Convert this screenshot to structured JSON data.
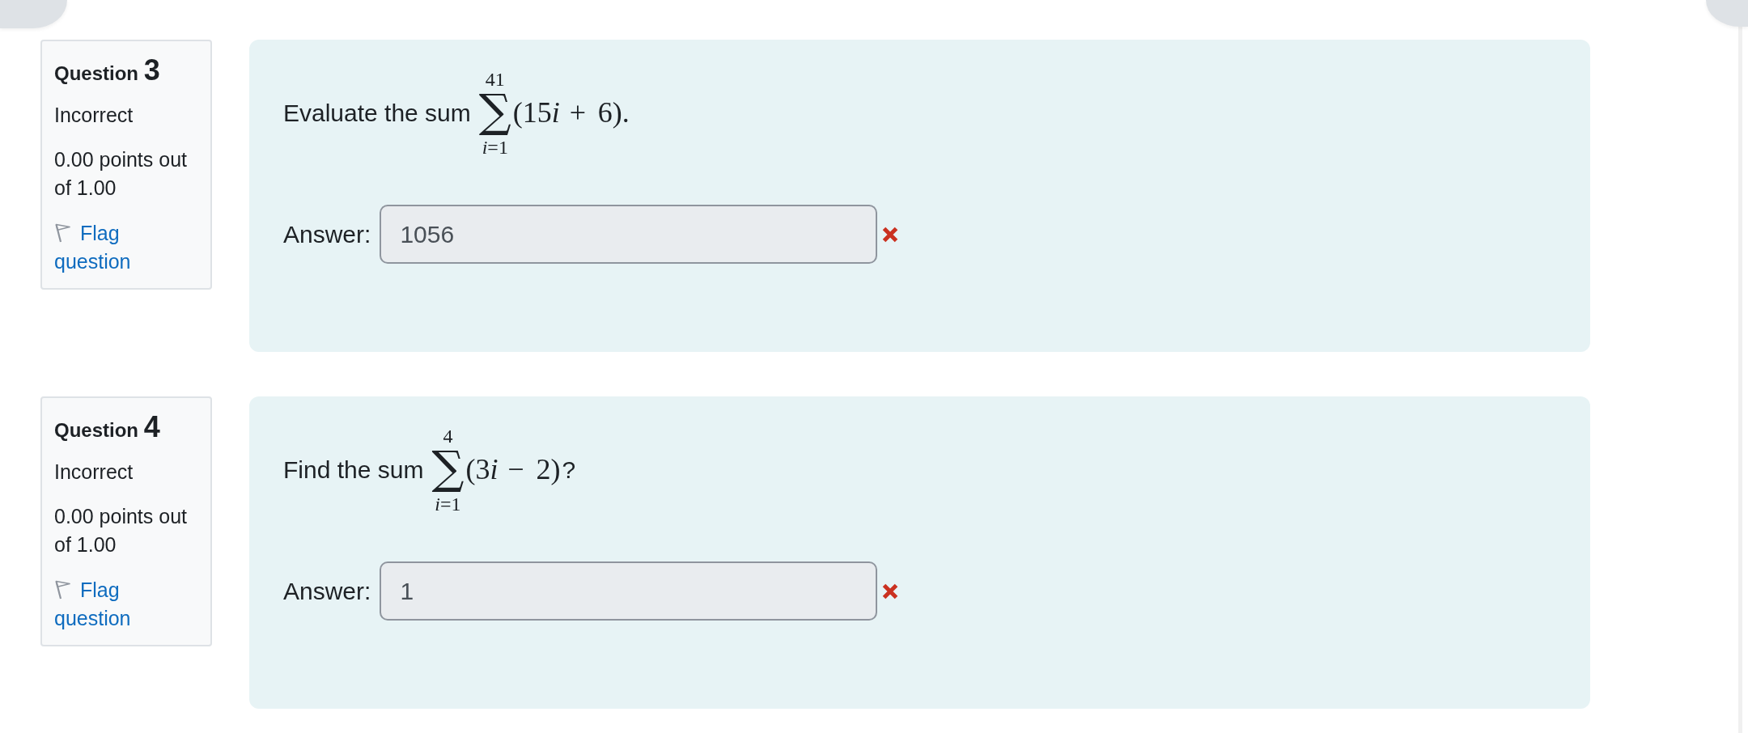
{
  "questions": [
    {
      "label": "Question",
      "number": "3",
      "status": "Incorrect",
      "grade": "0.00 points out of 1.00",
      "flag": {
        "label": "Flag question",
        "flagged": false
      },
      "prompt": "Evaluate the sum",
      "sum": {
        "symbol": "∑",
        "upper": "41",
        "lower": "*i*=1",
        "body": [
          {
            "kind": "number",
            "text": "(15"
          },
          {
            "kind": "variable",
            "text": "i"
          },
          {
            "kind": "operator",
            "text": " + "
          },
          {
            "kind": "number",
            "text": "6)."
          }
        ]
      },
      "answer": {
        "label": "Answer:",
        "value": "1056",
        "readonly": true,
        "correct": false
      }
    },
    {
      "label": "Question",
      "number": "4",
      "status": "Incorrect",
      "grade": "0.00 points out of 1.00",
      "flag": {
        "label": "Flag question",
        "flagged": false
      },
      "prompt": "Find the sum",
      "sum": {
        "symbol": "∑",
        "upper": "4",
        "lower": "*i*=1",
        "body": [
          {
            "kind": "number",
            "text": "(3"
          },
          {
            "kind": "variable",
            "text": "i"
          },
          {
            "kind": "operator",
            "text": " − "
          },
          {
            "kind": "number",
            "text": "2)"
          }
        ]
      },
      "suffix": "?",
      "answer": {
        "label": "Answer:",
        "value": "1",
        "readonly": true,
        "correct": false
      }
    }
  ]
}
